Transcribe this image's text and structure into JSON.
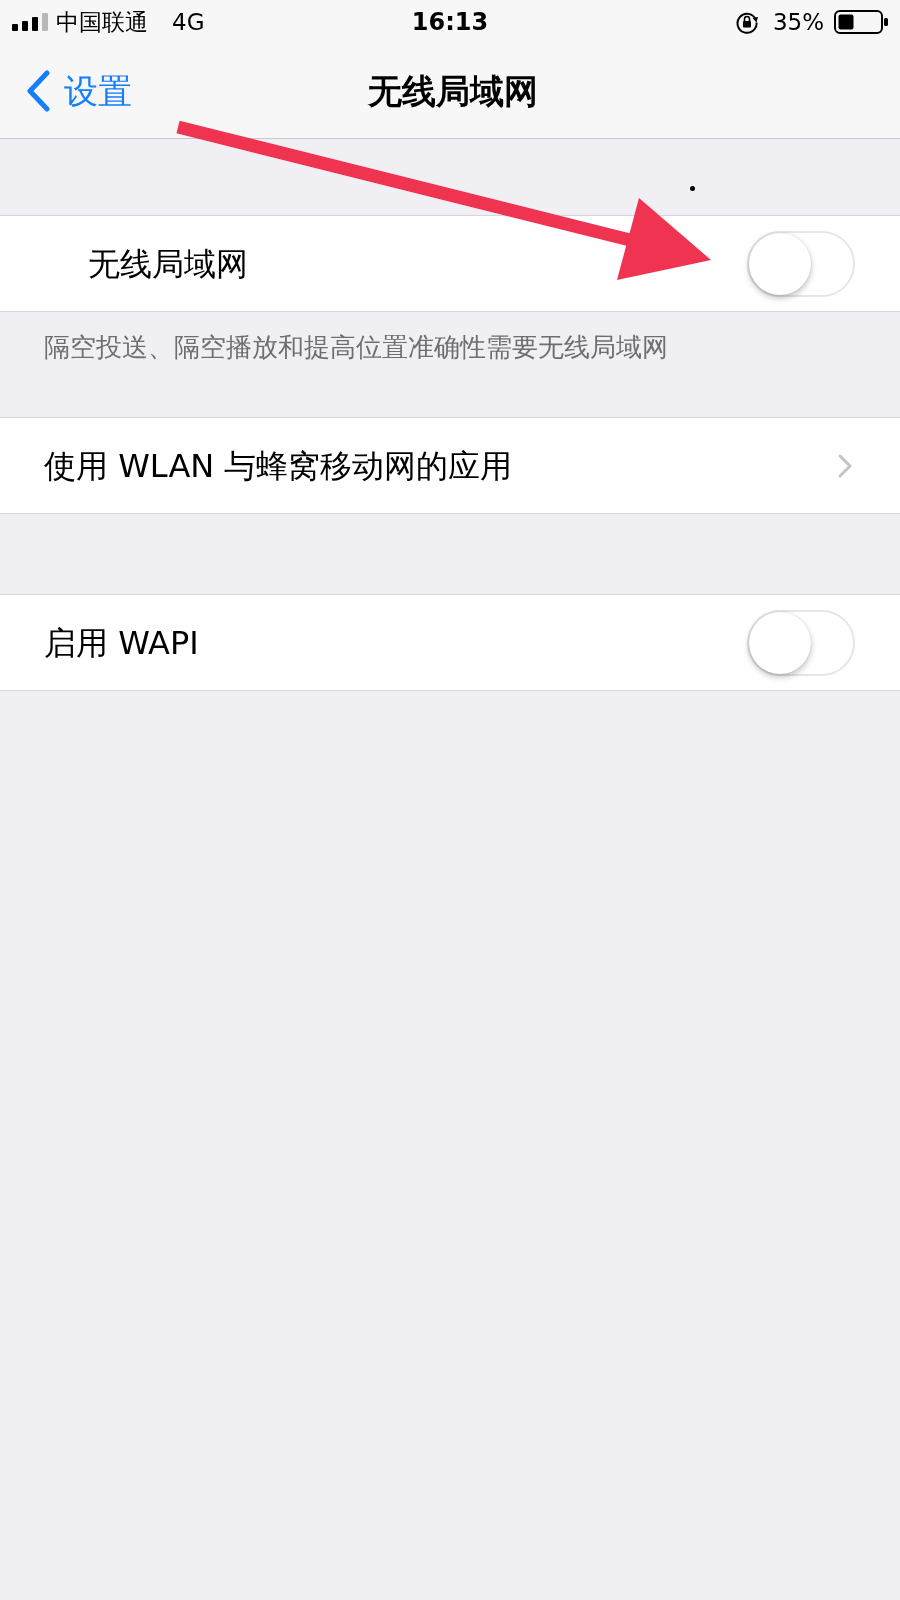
{
  "status_bar": {
    "carrier": "中国联通",
    "network": "4G",
    "time": "16:13",
    "battery": "35%"
  },
  "nav_bar": {
    "back": "设置",
    "title": "无线局域网"
  },
  "sections": [
    {
      "rows": [
        {
          "kind": "toggle",
          "label": "无线局域网",
          "on": false
        }
      ],
      "footer": "隔空投送、隔空播放和提高位置准确性需要无线局域网"
    },
    {
      "rows": [
        {
          "kind": "link",
          "label": "使用 WLAN 与蜂窝移动网的应用"
        }
      ]
    },
    {
      "rows": [
        {
          "kind": "toggle",
          "label": "启用 WAPI",
          "on": false
        }
      ]
    }
  ]
}
